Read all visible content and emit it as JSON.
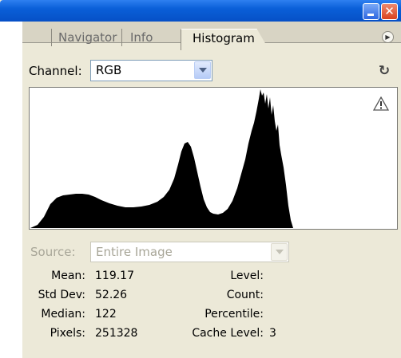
{
  "tabs": [
    {
      "label": "Navigator",
      "active": false
    },
    {
      "label": "Info",
      "active": false
    },
    {
      "label": "Histogram",
      "active": true
    }
  ],
  "channel": {
    "label": "Channel:",
    "value": "RGB"
  },
  "source": {
    "label": "Source:",
    "value": "Entire Image",
    "disabled": true
  },
  "stats": {
    "mean_label": "Mean:",
    "mean": "119.17",
    "std_label": "Std Dev:",
    "std": "52.26",
    "median_label": "Median:",
    "median": "122",
    "pixels_label": "Pixels:",
    "pixels": "251328",
    "level_label": "Level:",
    "level": "",
    "count_label": "Count:",
    "count": "",
    "percentile_label": "Percentile:",
    "percentile": "",
    "cache_label": "Cache Level:",
    "cache": "3"
  },
  "icons": {
    "minimize": "minimize-icon",
    "close": "close-icon",
    "panel_menu": "panel-menu-icon",
    "refresh": "refresh-icon",
    "warning": "warning-icon"
  },
  "colors": {
    "titlebar": "#0a5fd8",
    "panel_bg": "#ece9d8",
    "histogram_fill": "#000000"
  }
}
